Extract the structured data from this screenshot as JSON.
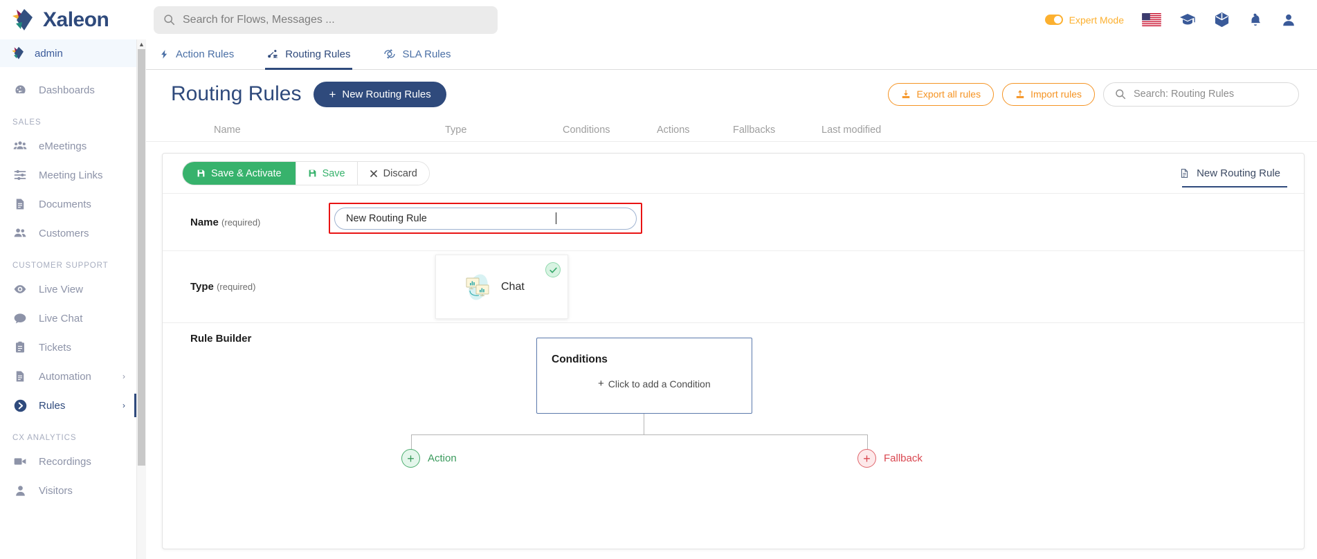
{
  "app": {
    "brand": "Xaleon",
    "brand_color": "#2f4a7c"
  },
  "header": {
    "search_placeholder": "Search for Flows, Messages ...",
    "search_icon": "search-icon",
    "expert_mode_label": "Expert Mode",
    "expert_mode_on": true,
    "expert_mode_color": "#fcb02f",
    "icons": [
      {
        "name": "flag-us-icon"
      },
      {
        "name": "graduation-cap-icon"
      },
      {
        "name": "package-box-icon"
      },
      {
        "name": "bell-notification-icon"
      },
      {
        "name": "user-account-icon"
      }
    ]
  },
  "sidebar": {
    "user": "admin",
    "groups": [
      {
        "section": "",
        "items": [
          {
            "label": "Dashboards",
            "icon": "dashboard-gauge-icon",
            "active": false,
            "chevron": false
          }
        ]
      },
      {
        "section": "SALES",
        "items": [
          {
            "label": "eMeetings",
            "icon": "users-group-icon",
            "active": false,
            "chevron": false
          },
          {
            "label": "Meeting Links",
            "icon": "sliders-icon",
            "active": false,
            "chevron": false
          },
          {
            "label": "Documents",
            "icon": "document-icon",
            "active": false,
            "chevron": false
          },
          {
            "label": "Customers",
            "icon": "users-pair-icon",
            "active": false,
            "chevron": false
          }
        ]
      },
      {
        "section": "CUSTOMER SUPPORT",
        "items": [
          {
            "label": "Live View",
            "icon": "eye-icon",
            "active": false,
            "chevron": false
          },
          {
            "label": "Live Chat",
            "icon": "chat-bubble-icon",
            "active": false,
            "chevron": false
          },
          {
            "label": "Tickets",
            "icon": "clipboard-icon",
            "active": false,
            "chevron": false
          },
          {
            "label": "Automation",
            "icon": "document-icon",
            "active": false,
            "chevron": true
          },
          {
            "label": "Rules",
            "icon": "arrow-circle-right-icon",
            "active": true,
            "chevron": true
          }
        ]
      },
      {
        "section": "CX ANALYTICS",
        "items": [
          {
            "label": "Recordings",
            "icon": "video-camera-icon",
            "active": false,
            "chevron": false
          },
          {
            "label": "Visitors",
            "icon": "person-icon",
            "active": false,
            "chevron": false
          }
        ]
      }
    ]
  },
  "tabs": [
    {
      "label": "Action Rules",
      "icon": "lightning-bolt-icon",
      "active": false
    },
    {
      "label": "Routing Rules",
      "icon": "routing-node-icon",
      "active": true
    },
    {
      "label": "SLA Rules",
      "icon": "sla-clock-icon",
      "active": false
    }
  ],
  "page": {
    "title": "Routing Rules",
    "new_button": "New Routing Rules",
    "new_button_icon": "plus-icon",
    "export_button": "Export all rules",
    "export_icon": "download-icon",
    "import_button": "Import rules",
    "import_icon": "upload-icon",
    "search_placeholder": "Search: Routing Rules",
    "search_icon": "search-icon"
  },
  "table": {
    "columns": [
      "Name",
      "Type",
      "Conditions",
      "Actions",
      "Fallbacks",
      "Last modified"
    ]
  },
  "editor": {
    "toolbar": {
      "save_activate": "Save & Activate",
      "save_activate_icon": "floppy-disk-icon",
      "save": "Save",
      "save_icon": "floppy-disk-icon",
      "discard": "Discard",
      "discard_icon": "close-x-icon"
    },
    "rule_chip": {
      "label": "New Routing Rule",
      "icon": "file-document-icon"
    },
    "name_field": {
      "label": "Name",
      "required_text": "(required)",
      "value": "New Routing Rule",
      "highlight_color": "#e81313"
    },
    "type_field": {
      "label": "Type",
      "required_text": "(required)",
      "selected": "Chat",
      "card_icon": "chat-screens-icon",
      "check_icon": "check-circle-icon"
    },
    "builder": {
      "title": "Rule Builder",
      "conditions_title": "Conditions",
      "add_condition": "Click to add a Condition",
      "add_condition_icon": "plus-icon",
      "action_label": "Action",
      "action_icon": "plus-circle-green-icon",
      "action_color": "#3a9a5c",
      "fallback_label": "Fallback",
      "fallback_icon": "plus-circle-red-icon",
      "fallback_color": "#d9464f"
    }
  }
}
